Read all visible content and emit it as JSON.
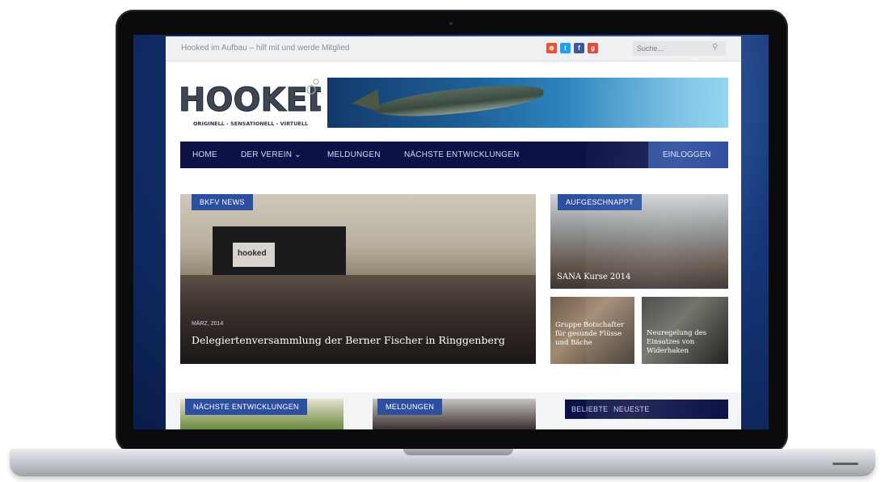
{
  "topbar": {
    "tagline": "Hooked im Aufbau – hilf mit und werde Mitglied",
    "search_placeholder": "Suche..."
  },
  "social": [
    {
      "icon": "rss-icon",
      "glyph": "⊚",
      "color": "#e4572e"
    },
    {
      "icon": "twitter-icon",
      "glyph": "t",
      "color": "#1da1f2"
    },
    {
      "icon": "facebook-icon",
      "glyph": "f",
      "color": "#3b5998"
    },
    {
      "icon": "google-plus-icon",
      "glyph": "g",
      "color": "#dd4b39"
    }
  ],
  "logo": {
    "name": "HOOKED",
    "tagline": "ORIGINELL - SENSATIONELL - VIRTUELL"
  },
  "nav": {
    "items": [
      "HOME",
      "DER VEREIN",
      "MELDUNGEN",
      "NÄCHSTE ENTWICKLUNGEN"
    ],
    "login": "EINLOGGEN"
  },
  "featured": {
    "main": {
      "category": "BKFV NEWS",
      "date": "MÄRZ, 2014",
      "title": "Delegiertenversammlung der Berner Fischer in Ringgenberg",
      "stage_text": "hooked"
    },
    "side_top": {
      "category": "AUFGESCHNAPPT",
      "title": "SANA Kurse 2014"
    },
    "side_left": {
      "title": "Gruppe Botschafter für gesunde Flüsse und Bäche"
    },
    "side_right": {
      "title": "Neuregelung des Einsatzes von Widerhaken"
    }
  },
  "bottom": {
    "card1_category": "NÄCHSTE ENTWICKLUNGEN",
    "card2_category": "MELDUNGEN",
    "tabs": [
      "BELIEBTE",
      "NEUESTE"
    ]
  },
  "colors": {
    "nav_bg": "#0d1147",
    "accent": "#2c4fa0"
  }
}
